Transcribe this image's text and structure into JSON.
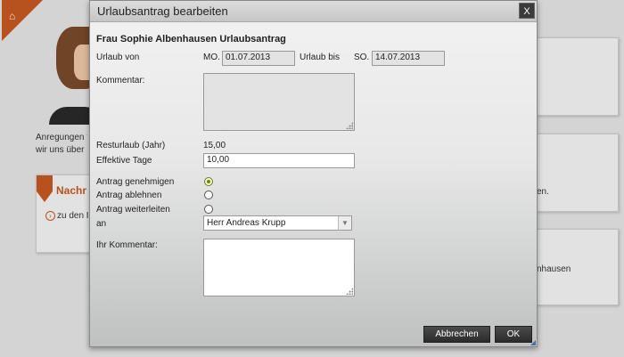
{
  "background": {
    "text_line1": "Anregungen f",
    "text_line2": "wir uns über I",
    "news_title": "Nachr",
    "news_link": "zu den I",
    "right_text1": "en.",
    "right_text2": "nhausen"
  },
  "dialog": {
    "title": "Urlaubsantrag bearbeiten",
    "close_label": "X",
    "heading": "Frau Sophie Albenhausen Urlaubsantrag",
    "urlaub_von_label": "Urlaub von",
    "von_day": "MO.",
    "von_date": "01.07.2013",
    "urlaub_bis_label": "Urlaub bis",
    "bis_day": "SO.",
    "bis_date": "14.07.2013",
    "kommentar_label": "Kommentar:",
    "kommentar_value": "",
    "resturlaub_label": "Resturlaub (Jahr)",
    "resturlaub_value": "15,00",
    "effektive_tage_label": "Effektive Tage",
    "effektive_tage_value": "10,00",
    "options": [
      {
        "label": "Antrag genehmigen",
        "checked": true
      },
      {
        "label": "Antrag ablehnen",
        "checked": false
      },
      {
        "label": "Antrag weiterleiten",
        "checked": false
      }
    ],
    "an_label": "an",
    "an_selected": "Herr Andreas Krupp",
    "ihr_kommentar_label": "Ihr Kommentar:",
    "ihr_kommentar_value": "",
    "cancel_label": "Abbrechen",
    "ok_label": "OK"
  },
  "colors": {
    "accent": "#c75a22",
    "button_dark": "#2b2b2b",
    "radio_checked": "#6a8a00"
  },
  "icons": [
    "home-icon",
    "close-icon",
    "chevron-down-icon",
    "arrow-right-icon",
    "envelope-icon"
  ]
}
